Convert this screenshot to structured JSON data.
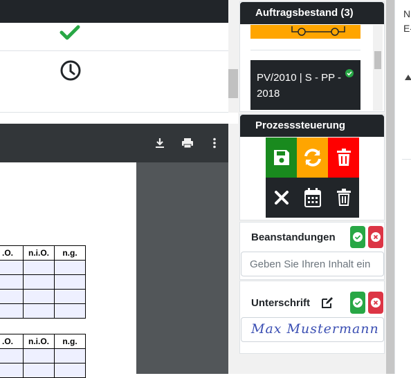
{
  "auftragsbestand": {
    "title": "Auftragsbestand (3)",
    "card_text": "PV/2010 | S - PP - 2018"
  },
  "prozess": {
    "title": "Prozesssteuerung"
  },
  "beanstandungen": {
    "label": "Beanstandungen",
    "placeholder": "Geben Sie Ihren Inhalt ein"
  },
  "unterschrift": {
    "label": "Unterschrift",
    "signature": "Max Mustermann"
  },
  "pdf_table": {
    "headers": [
      ".O.",
      "n.i.O.",
      "n.g."
    ]
  },
  "far_panel": {
    "line1": "N",
    "line2": "E-"
  },
  "colors": {
    "dark": "#212529",
    "green": "#198a1e",
    "orange": "#ffa500",
    "red": "#ff0000",
    "btn_green": "#28a745",
    "btn_red": "#dc3545"
  }
}
